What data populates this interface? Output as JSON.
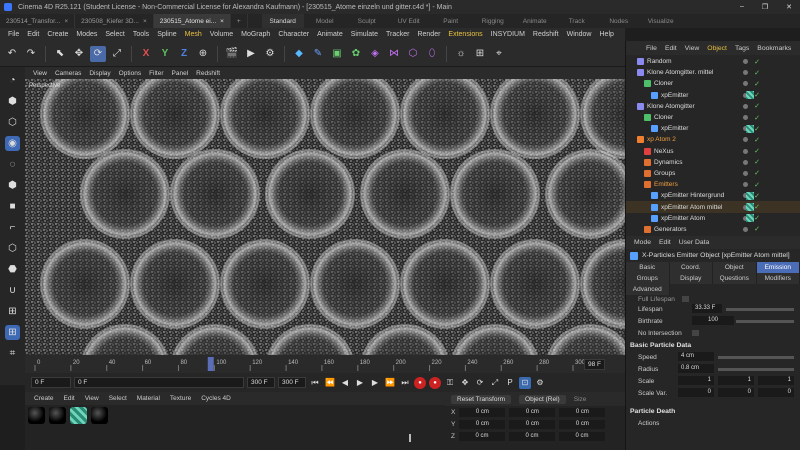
{
  "window": {
    "title": "Cinema 4D R25.121 (Student License - Non-Commercial License for Alexandra Kaufmann) - [230515_Atome einzeln und gitter.c4d *] - Main",
    "controls": [
      "–",
      "❐",
      "✕"
    ]
  },
  "doc_tabs": [
    {
      "label": "230514_Transfor...",
      "active": false
    },
    {
      "label": "230508_Kiefer 3D...",
      "active": false
    },
    {
      "label": "230515_Atome ei...",
      "active": true
    }
  ],
  "add_tab": "+",
  "layouts": [
    {
      "label": "Standard",
      "active": true
    },
    {
      "label": "Model",
      "active": false
    },
    {
      "label": "Sculpt",
      "active": false
    },
    {
      "label": "UV Edit",
      "active": false
    },
    {
      "label": "Paint",
      "active": false
    },
    {
      "label": "Rigging",
      "active": false
    },
    {
      "label": "Animate",
      "active": false
    },
    {
      "label": "Track",
      "active": false
    },
    {
      "label": "Nodes",
      "active": false
    },
    {
      "label": "Visualize",
      "active": false
    }
  ],
  "menubar": [
    "File",
    "Edit",
    "Create",
    "Modes",
    "Select",
    "Tools",
    "Spline",
    "Mesh",
    "Volume",
    "MoGraph",
    "Character",
    "Animate",
    "Simulate",
    "Tracker",
    "Render",
    "Extensions",
    "INSYDIUM",
    "Redshift",
    "Window",
    "Help"
  ],
  "menubar_highlight": [
    "Mesh",
    "Extensions"
  ],
  "toolbar": {
    "axis_labels": [
      "X",
      "Y",
      "Z"
    ],
    "icons": [
      "undo-icon",
      "redo-icon",
      "live-select-icon",
      "move-icon",
      "rotate-icon",
      "scale-icon",
      "axis-x",
      "axis-y",
      "axis-z",
      "coordinate-system-icon",
      "render-view-icon",
      "render-picture-viewer-icon",
      "render-settings-icon",
      "cube-icon",
      "pen-icon",
      "subdivision-icon",
      "cloner-icon",
      "deformer-icon",
      "field-icon",
      "scene-icon",
      "camera-icon",
      "light-icon",
      "grid-icon",
      "sketch-icon"
    ]
  },
  "viewport_menu": [
    "View",
    "Cameras",
    "Display",
    "Options",
    "Filter",
    "Panel",
    "Redshift"
  ],
  "viewport_label": "Perspective",
  "timeline": {
    "ticks": [
      "0",
      "20",
      "40",
      "60",
      "80",
      "100",
      "120",
      "140",
      "160",
      "180",
      "200",
      "220",
      "240",
      "260",
      "280",
      "300"
    ],
    "current_frame_box": "98 F"
  },
  "transport": {
    "start": "0 F",
    "current": "0 F",
    "end": "300 F",
    "end2": "300 F"
  },
  "material_menu": [
    "Create",
    "Edit",
    "View",
    "Select",
    "Material",
    "Texture",
    "Cycles 4D"
  ],
  "coordinates": {
    "reset_label": "Reset Transform",
    "mode_label": "Object (Rel)",
    "size_label": "Size",
    "rows": [
      {
        "axis": "X",
        "pos": "0 cm",
        "rot": "0 cm",
        "size": "0 cm"
      },
      {
        "axis": "Y",
        "pos": "0 cm",
        "rot": "0 cm",
        "size": "0 cm"
      },
      {
        "axis": "Z",
        "pos": "0 cm",
        "rot": "0 cm",
        "size": "0 cm"
      }
    ]
  },
  "object_manager": {
    "menu": [
      "File",
      "Edit",
      "View",
      "Object",
      "Tags",
      "Bookmarks"
    ],
    "menu_highlight": "Object",
    "items": [
      {
        "label": "Random",
        "indent": 1,
        "color": "#8a8af0",
        "tag": false,
        "sel": false,
        "active": false
      },
      {
        "label": "Klone Atomgitter. mittel",
        "indent": 1,
        "color": "#8a8af0",
        "tag": false,
        "sel": false,
        "active": false
      },
      {
        "label": "Cloner",
        "indent": 2,
        "color": "#4fc06a",
        "tag": false,
        "sel": false,
        "active": false
      },
      {
        "label": "xpEmitter",
        "indent": 3,
        "color": "#57a0ff",
        "tag": true,
        "sel": false,
        "active": false
      },
      {
        "label": "Klone Atomgitter",
        "indent": 1,
        "color": "#8a8af0",
        "tag": false,
        "sel": false,
        "active": false
      },
      {
        "label": "Cloner",
        "indent": 2,
        "color": "#4fc06a",
        "tag": false,
        "sel": false,
        "active": false
      },
      {
        "label": "xpEmitter",
        "indent": 3,
        "color": "#57a0ff",
        "tag": true,
        "sel": false,
        "active": false
      },
      {
        "label": "xp Atom 2",
        "indent": 1,
        "color": "#f08030",
        "tag": false,
        "sel": false,
        "active": true
      },
      {
        "label": "NeXus",
        "indent": 2,
        "color": "#e04040",
        "tag": false,
        "sel": false,
        "active": false
      },
      {
        "label": "Dynamics",
        "indent": 2,
        "color": "#e07030",
        "tag": false,
        "sel": false,
        "active": false
      },
      {
        "label": "Groups",
        "indent": 2,
        "color": "#e07030",
        "tag": false,
        "sel": false,
        "active": false
      },
      {
        "label": "Emitters",
        "indent": 2,
        "color": "#e07030",
        "tag": false,
        "sel": false,
        "active": true
      },
      {
        "label": "xpEmitter Hintergrund",
        "indent": 3,
        "color": "#57a0ff",
        "tag": true,
        "sel": false,
        "active": false
      },
      {
        "label": "xpEmitter Atom mittel",
        "indent": 3,
        "color": "#57a0ff",
        "tag": true,
        "sel": true,
        "active": false
      },
      {
        "label": "xpEmitter Atom",
        "indent": 3,
        "color": "#57a0ff",
        "tag": true,
        "sel": false,
        "active": false
      },
      {
        "label": "Generators",
        "indent": 2,
        "color": "#e07030",
        "tag": false,
        "sel": false,
        "active": false
      }
    ]
  },
  "attributes": {
    "menu": [
      "Mode",
      "Edit",
      "User Data"
    ],
    "title": "X-Particles Emitter Object [xpEmitter Atom mittel]",
    "tabs_row1": [
      {
        "label": "Basic",
        "on": false
      },
      {
        "label": "Coord.",
        "on": false
      },
      {
        "label": "Object",
        "on": false
      },
      {
        "label": "Emission",
        "on": true
      }
    ],
    "tabs_row2": [
      "Groups",
      "Display",
      "Questions",
      "Modifiers"
    ],
    "tabs_row3": [
      "Advanced"
    ],
    "full_lifespan": "Full Lifespan",
    "lifespan_label": "Lifespan",
    "lifespan_value": "33.33 F",
    "birthrate_label": "Birthrate",
    "birthrate_value": "100",
    "no_intersection": "No Intersection",
    "section_basic": "Basic Particle Data",
    "speed_label": "Speed",
    "speed_value": "4 cm",
    "radius_label": "Radius",
    "radius_value": "0.8 cm",
    "scale_label": "Scale",
    "scale_values": [
      "1",
      "1",
      "1"
    ],
    "scalevar_label": "Scale Var.",
    "scalevar_values": [
      "0",
      "0",
      "0"
    ],
    "section_death": "Particle Death",
    "actions_label": "Actions"
  }
}
